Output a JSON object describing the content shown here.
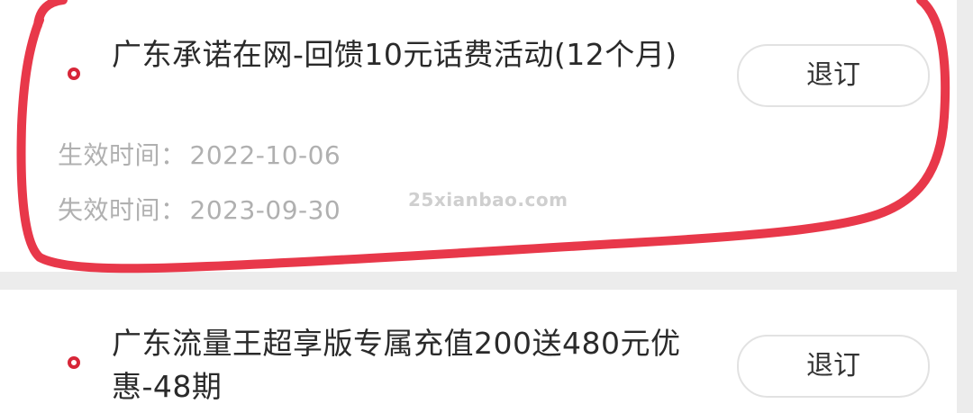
{
  "items": [
    {
      "title": "广东承诺在网-回馈10元话费活动(12个月)",
      "button_label": "退订",
      "effective_label": "生效时间：",
      "effective_value": "2022-10-06",
      "expire_label": "失效时间：",
      "expire_value": "2023-09-30"
    },
    {
      "title": "广东流量王超享版专属充值200送480元优惠-48期",
      "button_label": "退订"
    }
  ],
  "watermark": "25xianbao.com",
  "colors": {
    "accent": "#d72638",
    "highlight_stroke": "#e8384a",
    "background": "#ececec",
    "card": "#ffffff",
    "title_text": "#2a2a2a",
    "meta_text": "#b0b0b0"
  },
  "icons": {
    "bullet": "red-ring-bullet-icon"
  }
}
